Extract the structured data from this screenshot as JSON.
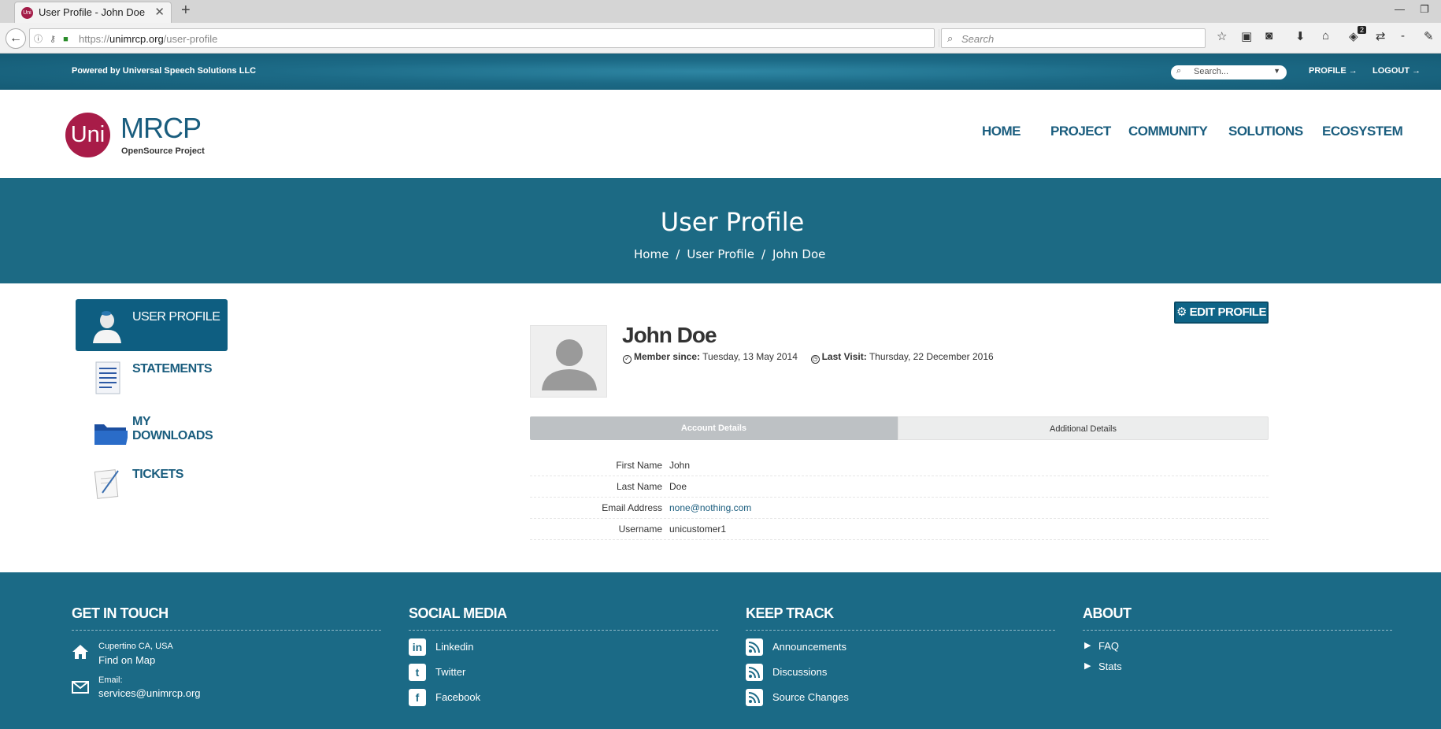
{
  "browser": {
    "tab_title": "User Profile - John Doe",
    "tab_close": "✕",
    "new_tab": "+",
    "url_prefix": "https://",
    "url_domain": "unimrcp.org",
    "url_path": "/user-profile",
    "search_placeholder": "Search",
    "notification_count": "2"
  },
  "topbar": {
    "powered_by": "Powered by Universal Speech Solutions LLC",
    "search_placeholder": "Search...",
    "profile_link": "PROFILE →",
    "logout_link": "LOGOUT →"
  },
  "header": {
    "logo_mark": "Uni",
    "logo_title": "MRCP",
    "logo_subtitle": "OpenSource Project",
    "nav": [
      "HOME",
      "PROJECT",
      "COMMUNITY",
      "SOLUTIONS",
      "ECOSYSTEM"
    ]
  },
  "banner": {
    "title": "User Profile",
    "breadcrumb": [
      "Home",
      "User Profile",
      "John Doe"
    ],
    "separator": "/"
  },
  "sidebar": {
    "items": [
      {
        "label": "USER PROFILE",
        "active": true
      },
      {
        "label": "STATEMENTS",
        "active": false
      },
      {
        "label": "MY DOWNLOADS",
        "active": false
      },
      {
        "label": "TICKETS",
        "active": false
      }
    ]
  },
  "profile": {
    "edit_button": "EDIT PROFILE",
    "name": "John Doe",
    "member_since_label": "Member since:",
    "member_since": "Tuesday, 13 May 2014",
    "last_visit_label": "Last Visit:",
    "last_visit": "Thursday, 22 December 2016",
    "tabs": [
      "Account Details",
      "Additional Details"
    ],
    "details": [
      {
        "label": "First Name",
        "value": "John"
      },
      {
        "label": "Last Name",
        "value": "Doe"
      },
      {
        "label": "Email Address",
        "value": "none@nothing.com"
      },
      {
        "label": "Username",
        "value": "unicustomer1"
      }
    ]
  },
  "footer": {
    "get_in_touch": {
      "title": "GET IN TOUCH",
      "location": "Cupertino CA, USA",
      "map_link": "Find on Map",
      "email_label": "Email:",
      "email": "services@unimrcp.org"
    },
    "social_media": {
      "title": "SOCIAL MEDIA",
      "items": [
        "Linkedin",
        "Twitter",
        "Facebook"
      ]
    },
    "keep_track": {
      "title": "KEEP TRACK",
      "items": [
        "Announcements",
        "Discussions",
        "Source Changes"
      ]
    },
    "about": {
      "title": "ABOUT",
      "items": [
        "FAQ",
        "Stats"
      ]
    }
  }
}
